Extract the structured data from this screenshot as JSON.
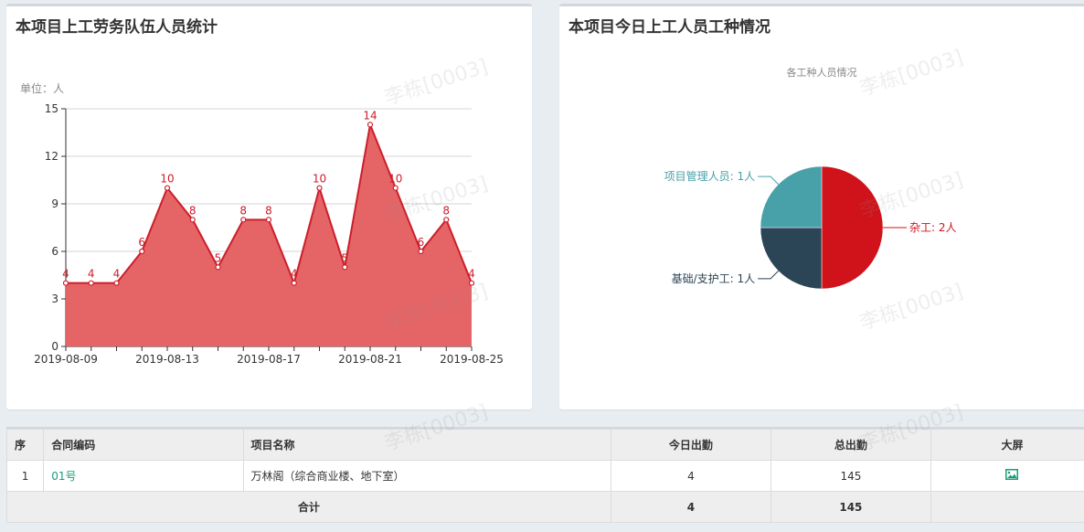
{
  "left_panel": {
    "title": "本项目上工劳务队伍人员统计"
  },
  "right_panel": {
    "title": "本项目今日上工人员工种情况"
  },
  "watermark_text": "李栋[0003]",
  "colors": {
    "line": "#cc1e2b",
    "area": "#e46163",
    "pie_red": "#d0121b",
    "pie_teal": "#48a0a9",
    "pie_navy": "#2b4456",
    "link": "#1a9c7a"
  },
  "chart_data": [
    {
      "type": "area",
      "unit_label": "单位：人",
      "x": [
        "2019-08-09",
        "2019-08-10",
        "2019-08-11",
        "2019-08-12",
        "2019-08-13",
        "2019-08-14",
        "2019-08-15",
        "2019-08-16",
        "2019-08-17",
        "2019-08-18",
        "2019-08-19",
        "2019-08-20",
        "2019-08-21",
        "2019-08-22",
        "2019-08-23",
        "2019-08-24",
        "2019-08-25"
      ],
      "values": [
        4,
        4,
        4,
        6,
        10,
        8,
        5,
        8,
        8,
        4,
        10,
        5,
        14,
        10,
        6,
        8,
        4
      ],
      "x_tick_labels": [
        "2019-08-09",
        "2019-08-13",
        "2019-08-17",
        "2019-08-21",
        "2019-08-25"
      ],
      "y_ticks": [
        0,
        3,
        6,
        9,
        12,
        15
      ],
      "ylim": [
        0,
        15
      ],
      "grid": true,
      "data_labels": true
    },
    {
      "type": "pie",
      "title": "各工种人员情况",
      "slices": [
        {
          "name": "杂工",
          "value": 2,
          "label": "杂工: 2人",
          "color": "#d0121b"
        },
        {
          "name": "基础/支护工",
          "value": 1,
          "label": "基础/支护工: 1人",
          "color": "#2b4456"
        },
        {
          "name": "项目管理人员",
          "value": 1,
          "label": "项目管理人员: 1人",
          "color": "#48a0a9"
        }
      ]
    }
  ],
  "table": {
    "headers": {
      "seq": "序",
      "contract": "合同编码",
      "project": "项目名称",
      "today": "今日出勤",
      "total": "总出勤",
      "screen": "大屏"
    },
    "rows": [
      {
        "seq": "1",
        "contract": "01号",
        "project": "万林阁（综合商业楼、地下室）",
        "today": "4",
        "total": "145",
        "screen_icon": "image-icon"
      }
    ],
    "footer": {
      "label": "合计",
      "today": "4",
      "total": "145"
    }
  }
}
